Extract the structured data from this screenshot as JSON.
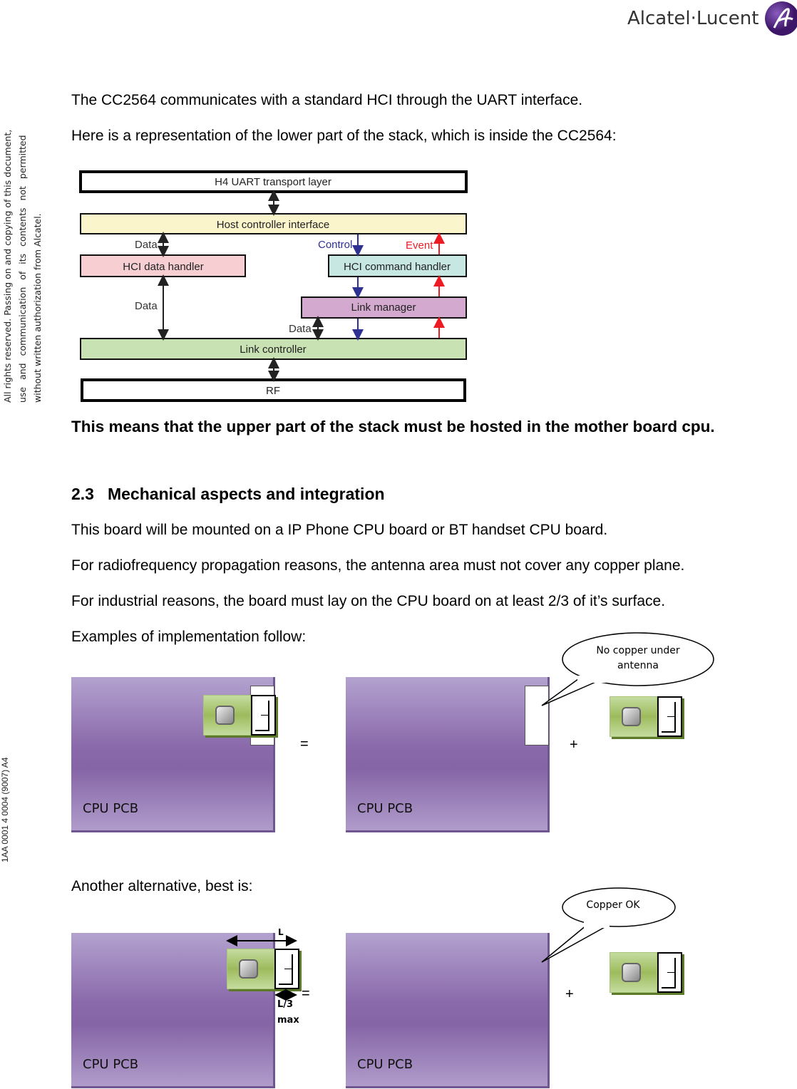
{
  "header": {
    "logo_text": "Alcatel·Lucent",
    "brand_color": "#5b2a86"
  },
  "sidebar": {
    "legal_lines": [
      "All rights reserved. Passing on and copying of this document,",
      "use and communication of its contents not permitted",
      "without written authorization from Alcatel."
    ],
    "doc_ref": "1AA 0001 4 0004 (9007) A4"
  },
  "body": {
    "p1": "The CC2564 communicates with a standard HCI through the UART interface.",
    "p2": "Here is a representation of the lower part of the stack, which is inside the CC2564:",
    "emphasis": "This means that the upper part of the stack must be hosted in the mother board cpu.",
    "section_number": "2.3",
    "section_title": "Mechanical aspects and integration",
    "p3": "This board will be mounted on a IP Phone CPU board or BT handset CPU board.",
    "p4": "For radiofrequency propagation reasons, the antenna area must not cover any copper plane.",
    "p5": "For industrial reasons, the board must lay on the CPU board on at least 2/3 of it’s surface.",
    "p6": "Examples of implementation follow:",
    "p7": "Another alternative, best is:"
  },
  "diagram": {
    "h4": "H4 UART transport layer",
    "hci": "Host controller interface",
    "data_handler": "HCI data handler",
    "cmd_handler": "HCI command handler",
    "link_manager": "Link manager",
    "link_controller": "Link controller",
    "rf": "RF",
    "data1": "Data",
    "data2": "Data",
    "data3": "Data",
    "control": "Control",
    "event": "Event",
    "colors": {
      "hci": "#fbf5cc",
      "data_handler": "#f7cfd2",
      "cmd_handler": "#c7e7e3",
      "link_manager": "#d4a9cf",
      "link_controller": "#c9e2b4",
      "control": "#2e3192",
      "event": "#ed1c24"
    }
  },
  "figures": {
    "pcb_label": "CPU PCB",
    "equals": "=",
    "plus": "+",
    "callout1": "No copper under antenna",
    "callout2": "Copper OK",
    "dim_L": "L",
    "dim_L3": "L/3",
    "dim_max": "max"
  }
}
